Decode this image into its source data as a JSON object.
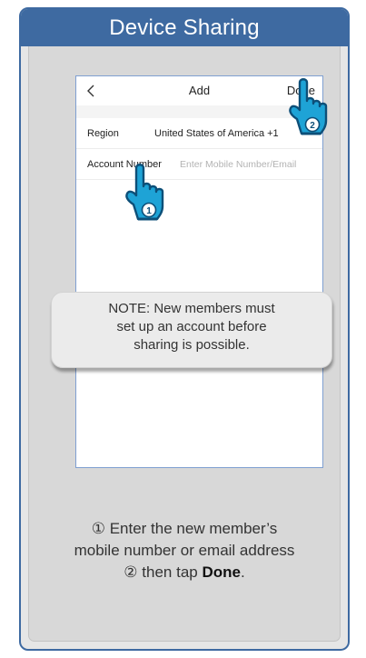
{
  "header": {
    "title": "Device Sharing"
  },
  "phone": {
    "nav": {
      "back_icon": "chevron-left-icon",
      "title": "Add",
      "done_label": "Done"
    },
    "region": {
      "label": "Region",
      "value": "United States of America +1"
    },
    "account": {
      "label": "Account Number",
      "placeholder": "Enter Mobile Number/Email",
      "value": ""
    }
  },
  "note": {
    "line1": "NOTE: New members must",
    "line2": "set up an account before",
    "line3": "sharing is possible."
  },
  "instructions": {
    "step1_marker": "①",
    "step1_line1": "Enter the new member’s",
    "step1_line2": "mobile number or email address",
    "step2_marker": "②",
    "step2_text": "then tap",
    "step2_action": "Done",
    "step2_end": "."
  },
  "pointers": {
    "first": {
      "number": "1",
      "icon": "tap-hand-icon"
    },
    "second": {
      "number": "2",
      "icon": "tap-hand-icon"
    }
  },
  "colors": {
    "brand_blue": "#3e6aa1",
    "hand_blue": "#1ea3d6",
    "hand_dark": "#0d4f78",
    "panel_gray": "#d8d8d8"
  }
}
